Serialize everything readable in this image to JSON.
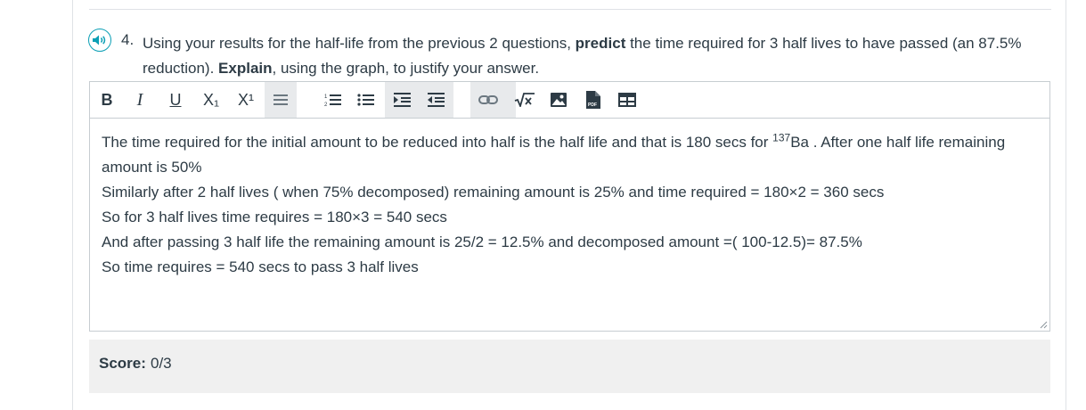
{
  "question": {
    "number": "4.",
    "text_part1": "Using your results for the half-life from the previous 2 questions, ",
    "bold1": "predict",
    "text_part2": " the time required for 3 half lives to have passed (an 87.5% reduction). ",
    "bold2": "Explain",
    "text_part3": ", using the graph, to justify your answer."
  },
  "toolbar": {
    "bold": "B",
    "italic": "I",
    "underline": "U",
    "subscript": "X₁",
    "superscript": "X¹"
  },
  "answer": {
    "line1_a": "The time required for the initial amount to be reduced into half is the half life and that is 180 secs for ",
    "line1_sup": "137",
    "line1_b": "Ba . After one half life remaining amount is 50%",
    "line2": "Similarly after 2 half lives ( when 75% decomposed) remaining amount is 25% and time required = 180×2 = 360 secs",
    "line3": "So for 3 half lives time requires = 180×3 = 540 secs",
    "line4": "And after passing 3 half life the remaining amount is 25/2 = 12.5% and decomposed amount =( 100-12.5)= 87.5%",
    "line5": "So time requires = 540 secs to pass 3 half lives"
  },
  "score": {
    "label": "Score:",
    "value": "0/3"
  },
  "colors": {
    "accent": "#0b9fb5",
    "text": "#2d3b45",
    "toolbar_active_bg": "#e8eaec",
    "score_bg": "#f0f0f0"
  },
  "icons": [
    "speaker-icon",
    "align-icon",
    "numbered-list-icon",
    "bullet-list-icon",
    "indent-icon",
    "outdent-icon",
    "link-icon",
    "math-icon",
    "image-icon",
    "pdf-icon",
    "table-icon"
  ]
}
